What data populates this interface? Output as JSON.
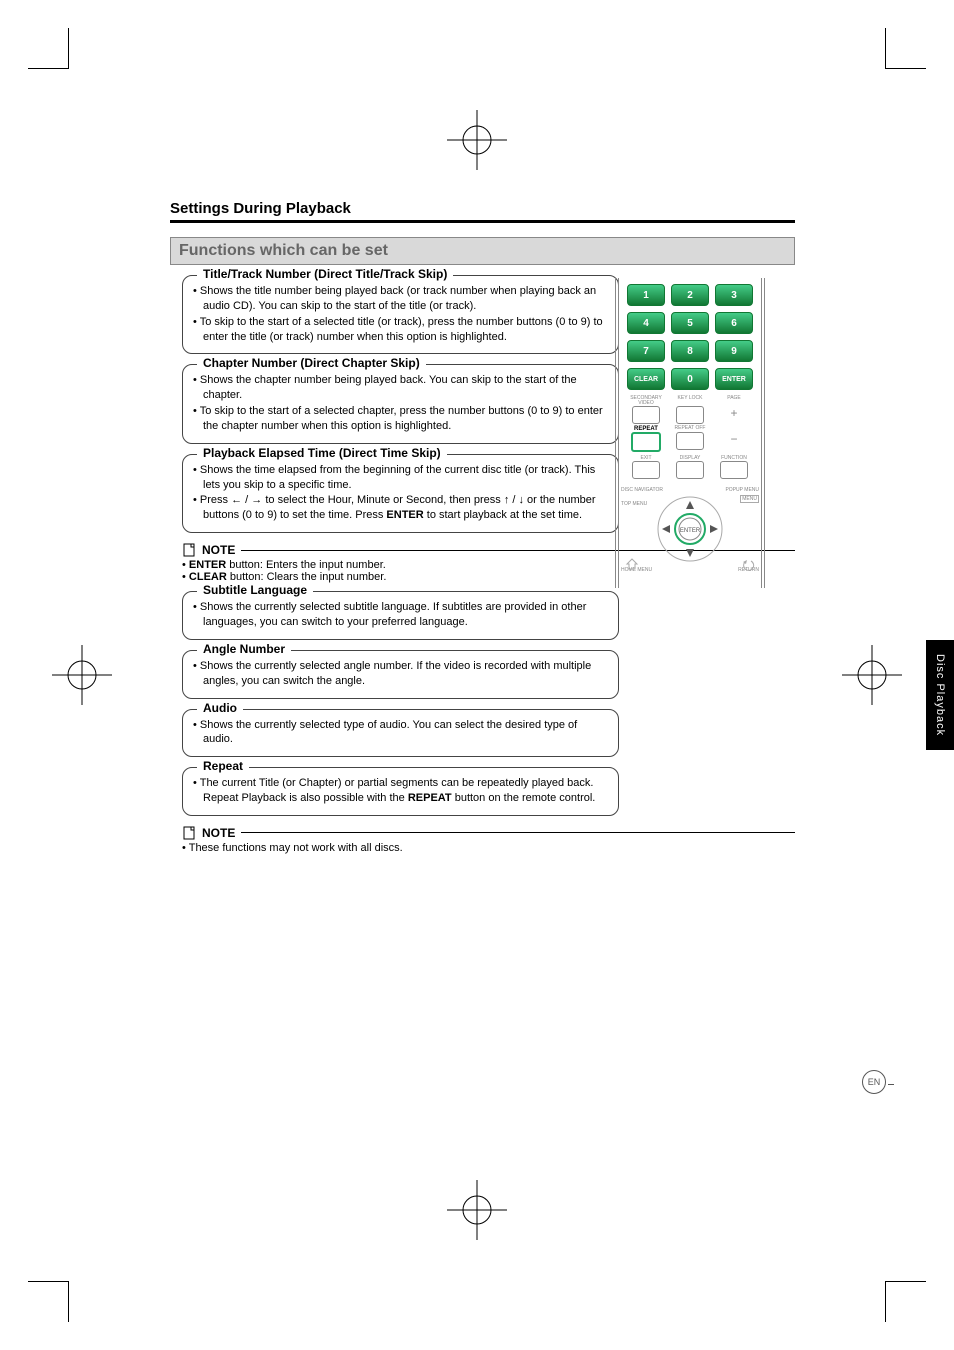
{
  "header": "Settings During Playback",
  "section_title": "Functions which can be set",
  "blocks": {
    "title_track": {
      "legend": "Title/Track Number (Direct Title/Track Skip)",
      "items": [
        "Shows the title number being played back (or track number when playing back an audio CD). You can skip to the start of the title (or track).",
        "To skip to the start of a selected title (or track), press the number buttons (0 to 9) to enter the title (or track) number when this option is highlighted."
      ]
    },
    "chapter": {
      "legend": "Chapter Number (Direct Chapter Skip)",
      "items": [
        "Shows the chapter number being played back. You can skip to the start of the chapter.",
        "To skip to the start of a selected chapter, press the number buttons (0 to 9) to enter the chapter number when this option is highlighted."
      ]
    },
    "elapsed": {
      "legend": "Playback Elapsed Time (Direct Time Skip)",
      "items": [
        "Shows the time elapsed from the beginning of the current disc title (or track). This lets you skip to a specific time."
      ],
      "item3_pre": "Press ",
      "item3_mid1": " to select the Hour, Minute or  Second, then press ",
      "item3_mid2": "  or the number buttons (0 to 9) to set the time. Press ",
      "item3_enter": "ENTER",
      "item3_post": " to start playback at the set time.",
      "arrows_lr": "← / →",
      "arrows_ud": "↑ / ↓"
    },
    "subtitle": {
      "legend": "Subtitle Language",
      "items": [
        "Shows the currently selected subtitle language. If subtitles are provided in other languages, you can switch to your preferred language."
      ]
    },
    "angle": {
      "legend": "Angle Number",
      "items": [
        "Shows the currently selected angle number. If the video is recorded with multiple angles, you can switch the angle."
      ]
    },
    "audio": {
      "legend": "Audio",
      "items": [
        "Shows the currently selected type of audio. You can select the desired type of audio."
      ]
    },
    "repeat": {
      "legend": "Repeat",
      "item1_pre": "The current Title (or Chapter) or partial segments can be repeatedly played back. Repeat Playback is also possible with the ",
      "item1_bold": "REPEAT",
      "item1_post": " button on the remote control."
    }
  },
  "note1": {
    "label": "NOTE",
    "l1_bold": "ENTER",
    "l1_rest": " button: Enters the input number.",
    "l2_bold": "CLEAR",
    "l2_rest": " button: Clears the input number."
  },
  "note2": {
    "label": "NOTE",
    "l1": "These functions may not work with all discs."
  },
  "remote": {
    "keys": [
      "1",
      "2",
      "3",
      "4",
      "5",
      "6",
      "7",
      "8",
      "9",
      "CLEAR",
      "0",
      "ENTER"
    ],
    "row_labels1": [
      "SECONDARY VIDEO",
      "KEY LOCK",
      "PAGE"
    ],
    "repeat": "REPEAT",
    "repeat_off": "REPEAT OFF",
    "row_labels2": [
      "EXIT",
      "DISPLAY",
      "FUNCTION"
    ],
    "nav_labels": {
      "tl": "DISC NAVIGATOR",
      "tr": "POPUP MENU",
      "trm": "MENU",
      "tc": "TOP MENU",
      "bl": "HOME MENU",
      "br": "RETURN",
      "center": "ENTER"
    }
  },
  "sidetab": "Disc Playback",
  "en": "EN"
}
